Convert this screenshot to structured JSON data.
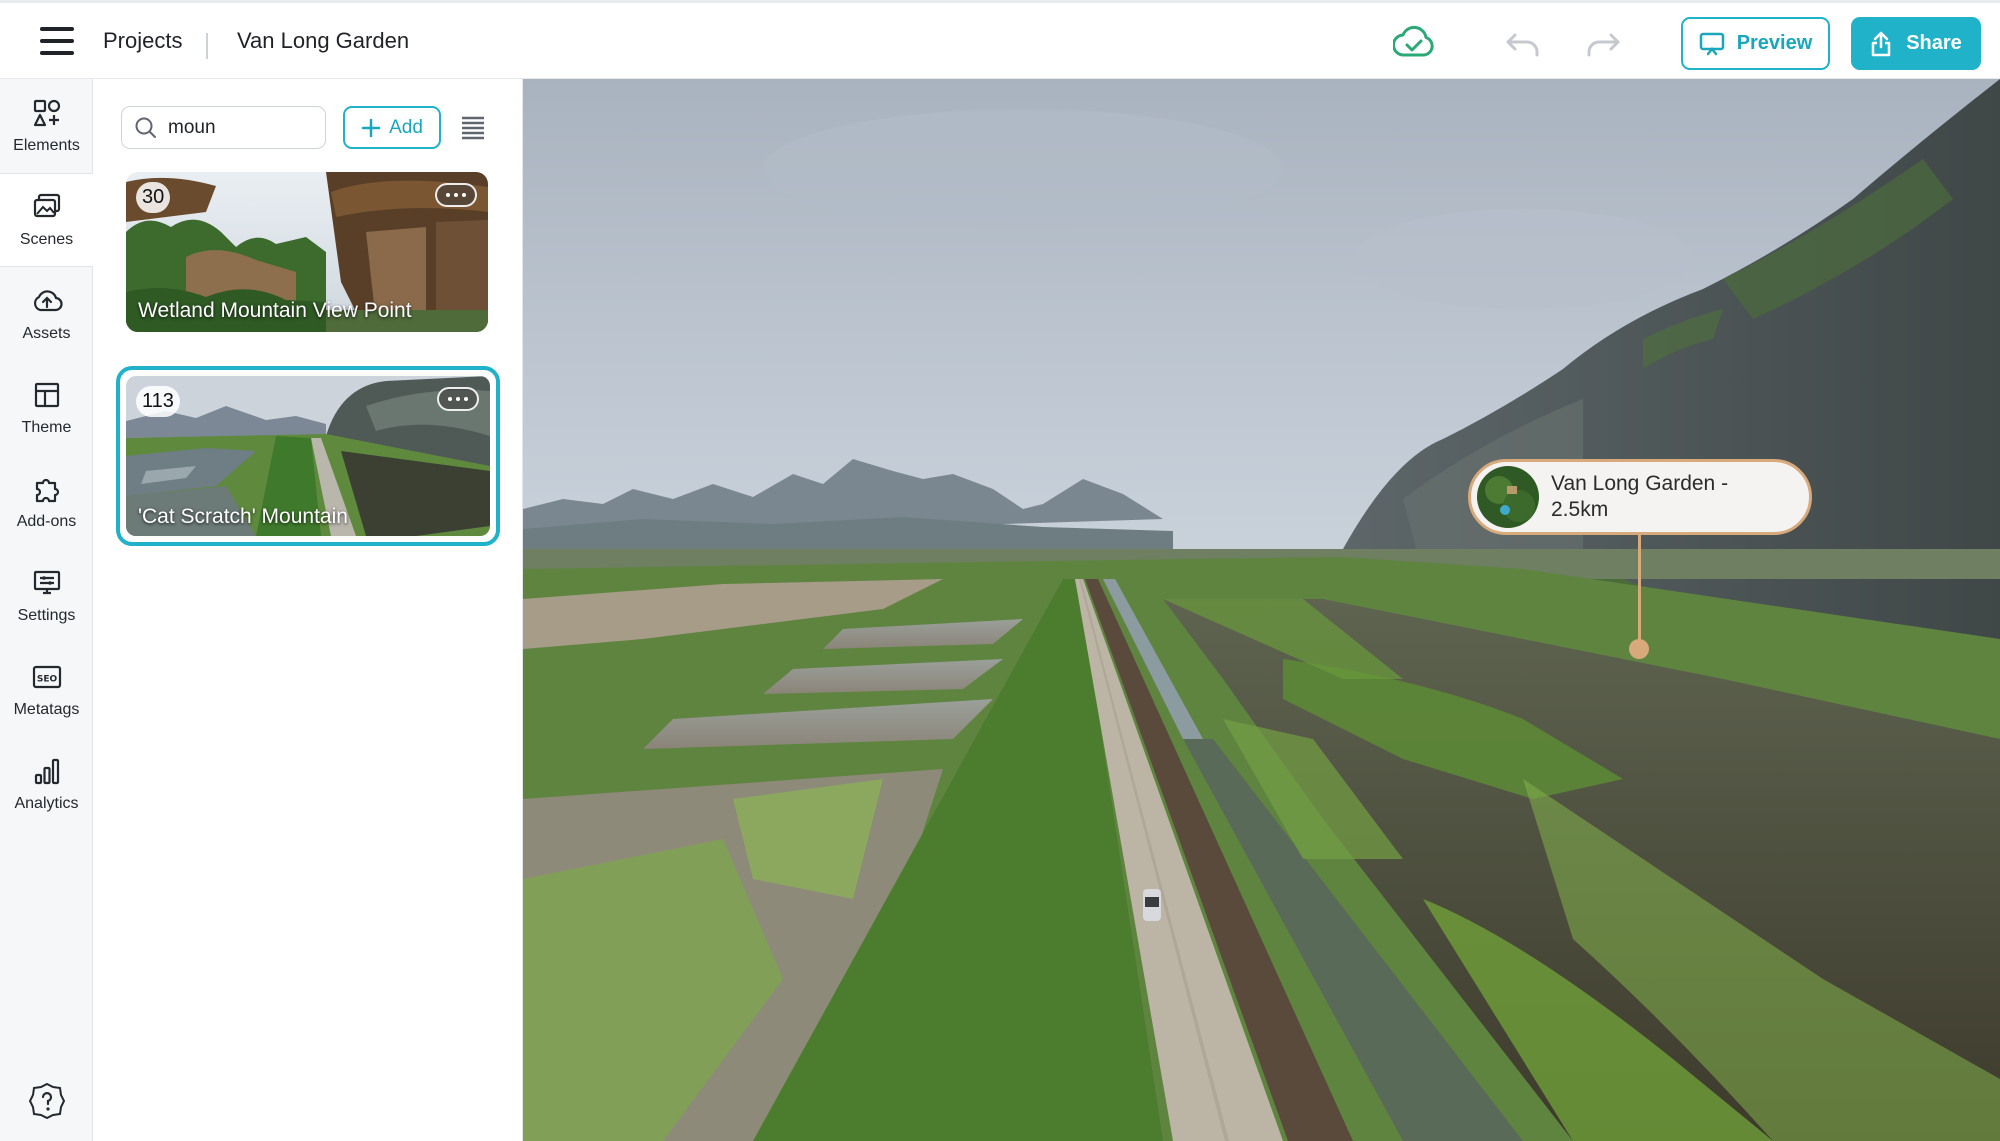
{
  "header": {
    "breadcrumb_projects": "Projects",
    "project_name": "Van Long Garden",
    "preview_label": "Preview",
    "share_label": "Share",
    "accent_color": "#1fb2c9",
    "sync_status_icon": "cloud-check-icon"
  },
  "sidebar": {
    "items": [
      {
        "label": "Elements",
        "icon": "elements-icon"
      },
      {
        "label": "Scenes",
        "icon": "scenes-icon"
      },
      {
        "label": "Assets",
        "icon": "cloud-upload-icon"
      },
      {
        "label": "Theme",
        "icon": "layout-icon"
      },
      {
        "label": "Add-ons",
        "icon": "puzzle-icon"
      },
      {
        "label": "Settings",
        "icon": "settings-icon"
      },
      {
        "label": "Metatags",
        "icon": "seo-icon"
      },
      {
        "label": "Analytics",
        "icon": "bar-chart-icon"
      }
    ],
    "active": "Scenes"
  },
  "scenes_panel": {
    "search_value": "moun",
    "add_label": "Add",
    "scenes": [
      {
        "number": "30",
        "title": "Wetland Mountain View Point",
        "selected": false
      },
      {
        "number": "113",
        "title": "'Cat Scratch' Mountain",
        "selected": true
      }
    ]
  },
  "viewer": {
    "hotspot_label": "Van Long Garden - 2.5km"
  }
}
